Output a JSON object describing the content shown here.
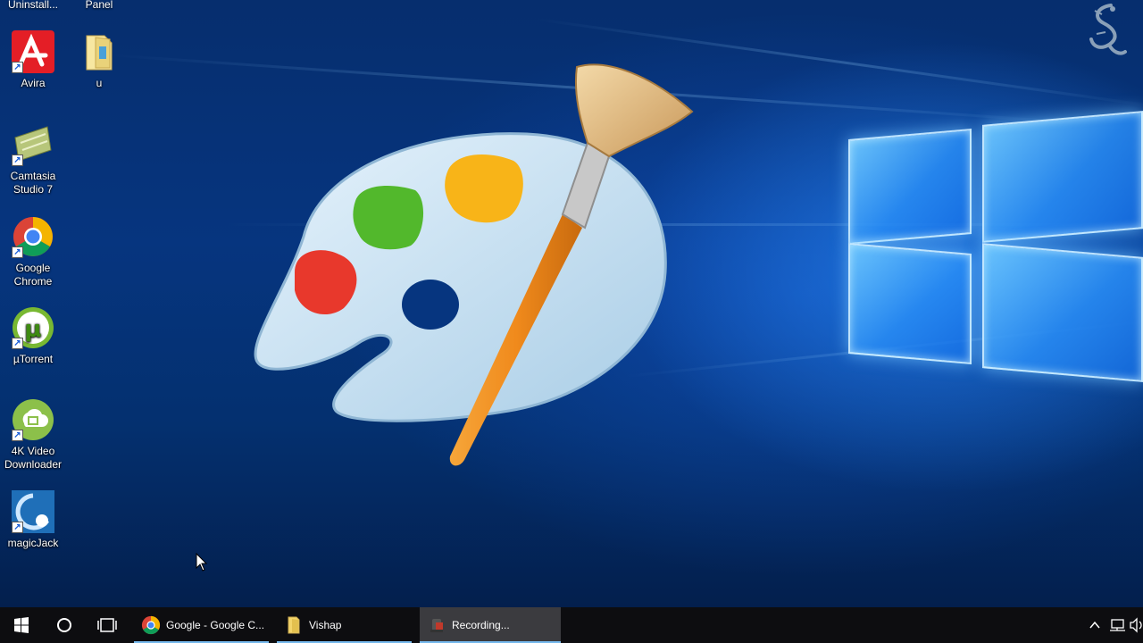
{
  "desktop": {
    "top_labels": [
      "Uninstall...",
      "Panel"
    ],
    "icons": [
      {
        "label": "Avira"
      },
      {
        "label": "u"
      },
      {
        "label": "Camtasia Studio 7"
      },
      {
        "label": "Google Chrome"
      },
      {
        "label": "µTorrent"
      },
      {
        "label": "4K Video Downloader"
      },
      {
        "label": "magicJack"
      }
    ],
    "center_graphic": "paint-palette-icon",
    "watermark": "dragon-logo"
  },
  "taskbar": {
    "start": "windows-start-icon",
    "search": "cortana-circle-icon",
    "task_view": "task-view-icon",
    "tasks": [
      {
        "label": "Google - Google C...",
        "icon": "chrome-icon"
      },
      {
        "label": "Vishap",
        "icon": "folder-icon"
      },
      {
        "label": "Recording...",
        "icon": "recorder-icon"
      }
    ],
    "tray": [
      "chevron-up-icon",
      "network-icon",
      "volume-icon"
    ]
  },
  "colors": {
    "taskbar_bg": "#0d0d10",
    "active_task_bg": "#3b3b3f",
    "task_underline": "#76b9ed",
    "desktop_blue": "#06357f"
  }
}
